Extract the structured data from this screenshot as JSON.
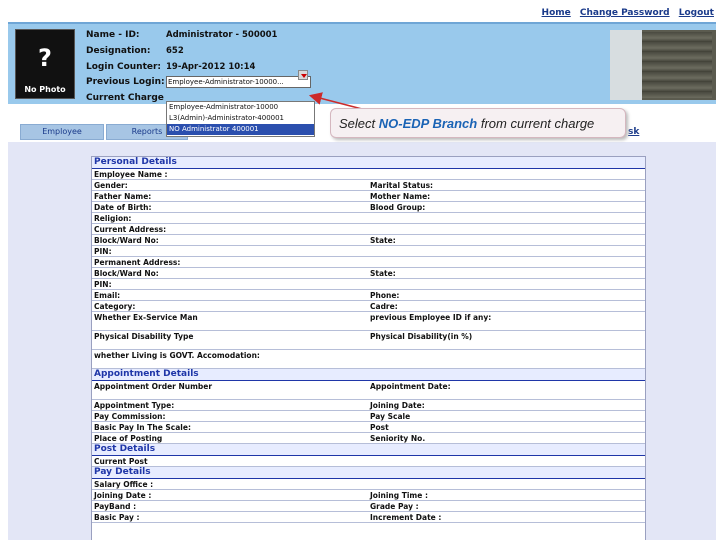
{
  "top_links": [
    "Home",
    "Change Password",
    "Logout"
  ],
  "profile": {
    "photo_label": "No Photo",
    "photo_glyph": "?",
    "labels": [
      "Name - ID:",
      "Designation:",
      "Login Counter:",
      "Previous Login:",
      "Current Charge"
    ],
    "values": {
      "name_id": "Administrator - 500001",
      "designation": "",
      "login_counter": "652",
      "previous_login": "19-Apr-2012 10:14",
      "current_charge": "Employee-Administrator-10000..."
    }
  },
  "dropdown_options": [
    "Employee-Administrator-10000",
    "L3(Admin)-Administrator-400001",
    "NO Administrator 400001"
  ],
  "tabs": [
    "Employee",
    "Reports"
  ],
  "desk_link": "sk",
  "callout": {
    "prefix": "Select ",
    "highlight": "NO-EDP Branch",
    "suffix": " from current charge"
  },
  "form": {
    "sections": {
      "personal": "Personal Details",
      "appointment": "Appointment Details",
      "post": "Post Details",
      "pay": "Pay Details"
    },
    "personal_rows": [
      {
        "l": "Employee Name :",
        "r": ""
      },
      {
        "l": "Gender:",
        "r": "Marital Status:"
      },
      {
        "l": "Father Name:",
        "r": "Mother Name:"
      },
      {
        "l": "Date of Birth:",
        "r": "Blood Group:"
      },
      {
        "l": "Religion:",
        "r": ""
      },
      {
        "l": "Current Address:",
        "r": ""
      },
      {
        "l": "Block/Ward No:",
        "r": "State:"
      },
      {
        "l": "PIN:",
        "r": ""
      },
      {
        "l": "Permanent Address:",
        "r": ""
      },
      {
        "l": "Block/Ward No:",
        "r": "State:"
      },
      {
        "l": "PIN:",
        "r": ""
      },
      {
        "l": "Email:",
        "r": "Phone:"
      },
      {
        "l": "Category:",
        "r": "Cadre:"
      },
      {
        "l": "Whether Ex-Service Man",
        "r": "previous Employee ID if any:"
      },
      {
        "l": "Physical Disability Type",
        "r": "Physical Disability(in %)"
      },
      {
        "l": "whether Living is GOVT. Accomodation:",
        "r": ""
      }
    ],
    "appointment_rows": [
      {
        "l": "Appointment Order Number",
        "r": "Appointment Date:"
      },
      {
        "l": "Appointment Type:",
        "r": "Joining Date:"
      },
      {
        "l": "Pay Commission:",
        "r": "Pay Scale"
      },
      {
        "l": "Basic Pay In The Scale:",
        "r": "Post"
      },
      {
        "l": "Place of Posting",
        "r": "Seniority No."
      }
    ],
    "post_rows": [
      {
        "l": "Current Post",
        "r": ""
      }
    ],
    "pay_rows": [
      {
        "l": "Salary Office :",
        "r": ""
      },
      {
        "l": "Joining Date :",
        "r": "Joining Time :"
      },
      {
        "l": "PayBand :",
        "r": "Grade Pay :"
      },
      {
        "l": "Basic Pay :",
        "r": "Increment Date :"
      }
    ]
  },
  "colors": {
    "profile_bg": "#99c9ec",
    "main_bg": "#e3e6f6",
    "section_text": "#1f36a8",
    "callout_highlight": "#1a63b5",
    "arrow": "#cc2a2a"
  }
}
